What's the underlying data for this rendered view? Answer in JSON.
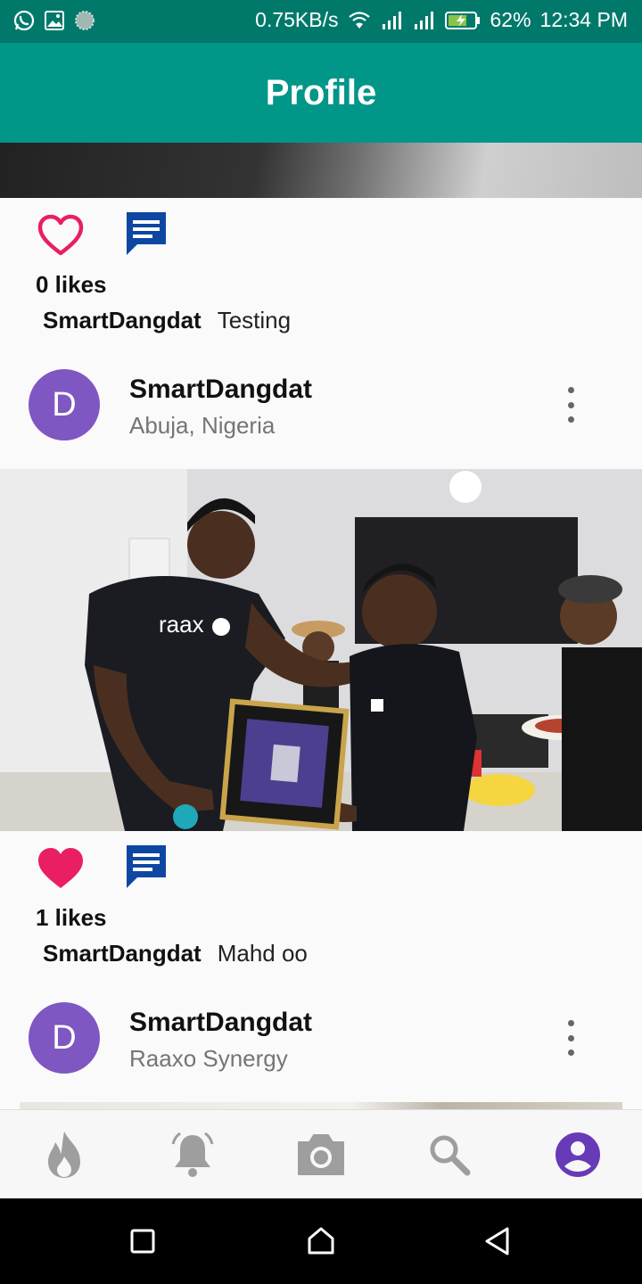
{
  "status_bar": {
    "speed": "0.75KB/s",
    "battery": "62%",
    "time": "12:34 PM",
    "icons": [
      "whatsapp-icon",
      "gallery-icon",
      "app-icon",
      "wifi-icon",
      "signal-icon",
      "battery-icon"
    ]
  },
  "app_bar": {
    "title": "Profile"
  },
  "posts": [
    {
      "likes": "0 likes",
      "liked": false,
      "caption_user": "SmartDangdat",
      "caption_text": "Testing"
    },
    {
      "header_name": "SmartDangdat",
      "header_location": "Abuja, Nigeria",
      "avatar_letter": "D",
      "photo_logo_text": "raax",
      "likes": "1 likes",
      "liked": true,
      "caption_user": "SmartDangdat",
      "caption_text": "Mahd oo"
    },
    {
      "header_name": "SmartDangdat",
      "header_location": "Raaxo Synergy",
      "avatar_letter": "D"
    }
  ],
  "bottom_nav": {
    "items": [
      "fire-icon",
      "bell-icon",
      "camera-icon",
      "search-icon",
      "profile-icon"
    ],
    "active": "profile-icon"
  },
  "colors": {
    "status_bar": "#00796b",
    "app_bar": "#009688",
    "like": "#e91e63",
    "comment": "#0d47a1",
    "avatar": "#7e57c2",
    "nav_inactive": "#9e9e9e",
    "nav_active": "#673ab7"
  }
}
